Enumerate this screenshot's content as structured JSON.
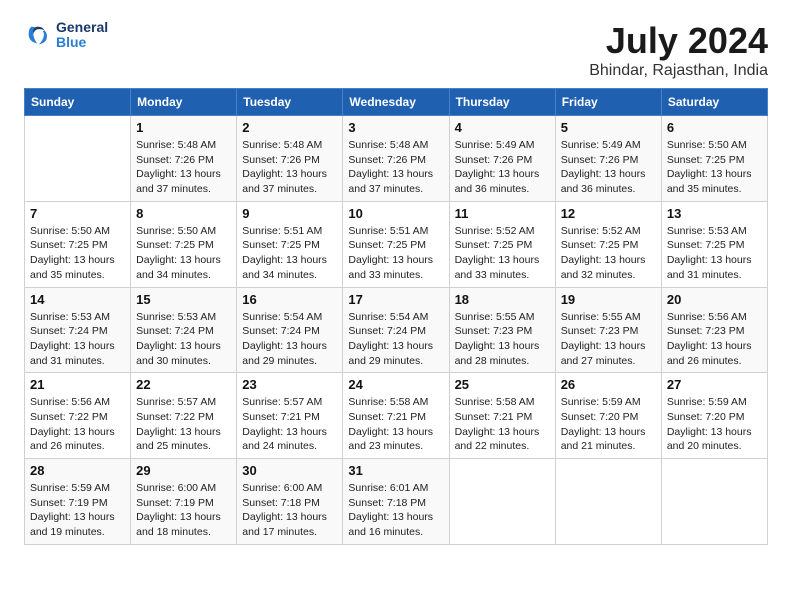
{
  "header": {
    "logo_general": "General",
    "logo_blue": "Blue",
    "month_title": "July 2024",
    "location": "Bhindar, Rajasthan, India"
  },
  "calendar": {
    "weekdays": [
      "Sunday",
      "Monday",
      "Tuesday",
      "Wednesday",
      "Thursday",
      "Friday",
      "Saturday"
    ],
    "weeks": [
      [
        {
          "day": "",
          "info": ""
        },
        {
          "day": "1",
          "info": "Sunrise: 5:48 AM\nSunset: 7:26 PM\nDaylight: 13 hours\nand 37 minutes."
        },
        {
          "day": "2",
          "info": "Sunrise: 5:48 AM\nSunset: 7:26 PM\nDaylight: 13 hours\nand 37 minutes."
        },
        {
          "day": "3",
          "info": "Sunrise: 5:48 AM\nSunset: 7:26 PM\nDaylight: 13 hours\nand 37 minutes."
        },
        {
          "day": "4",
          "info": "Sunrise: 5:49 AM\nSunset: 7:26 PM\nDaylight: 13 hours\nand 36 minutes."
        },
        {
          "day": "5",
          "info": "Sunrise: 5:49 AM\nSunset: 7:26 PM\nDaylight: 13 hours\nand 36 minutes."
        },
        {
          "day": "6",
          "info": "Sunrise: 5:50 AM\nSunset: 7:25 PM\nDaylight: 13 hours\nand 35 minutes."
        }
      ],
      [
        {
          "day": "7",
          "info": "Sunrise: 5:50 AM\nSunset: 7:25 PM\nDaylight: 13 hours\nand 35 minutes."
        },
        {
          "day": "8",
          "info": "Sunrise: 5:50 AM\nSunset: 7:25 PM\nDaylight: 13 hours\nand 34 minutes."
        },
        {
          "day": "9",
          "info": "Sunrise: 5:51 AM\nSunset: 7:25 PM\nDaylight: 13 hours\nand 34 minutes."
        },
        {
          "day": "10",
          "info": "Sunrise: 5:51 AM\nSunset: 7:25 PM\nDaylight: 13 hours\nand 33 minutes."
        },
        {
          "day": "11",
          "info": "Sunrise: 5:52 AM\nSunset: 7:25 PM\nDaylight: 13 hours\nand 33 minutes."
        },
        {
          "day": "12",
          "info": "Sunrise: 5:52 AM\nSunset: 7:25 PM\nDaylight: 13 hours\nand 32 minutes."
        },
        {
          "day": "13",
          "info": "Sunrise: 5:53 AM\nSunset: 7:25 PM\nDaylight: 13 hours\nand 31 minutes."
        }
      ],
      [
        {
          "day": "14",
          "info": "Sunrise: 5:53 AM\nSunset: 7:24 PM\nDaylight: 13 hours\nand 31 minutes."
        },
        {
          "day": "15",
          "info": "Sunrise: 5:53 AM\nSunset: 7:24 PM\nDaylight: 13 hours\nand 30 minutes."
        },
        {
          "day": "16",
          "info": "Sunrise: 5:54 AM\nSunset: 7:24 PM\nDaylight: 13 hours\nand 29 minutes."
        },
        {
          "day": "17",
          "info": "Sunrise: 5:54 AM\nSunset: 7:24 PM\nDaylight: 13 hours\nand 29 minutes."
        },
        {
          "day": "18",
          "info": "Sunrise: 5:55 AM\nSunset: 7:23 PM\nDaylight: 13 hours\nand 28 minutes."
        },
        {
          "day": "19",
          "info": "Sunrise: 5:55 AM\nSunset: 7:23 PM\nDaylight: 13 hours\nand 27 minutes."
        },
        {
          "day": "20",
          "info": "Sunrise: 5:56 AM\nSunset: 7:23 PM\nDaylight: 13 hours\nand 26 minutes."
        }
      ],
      [
        {
          "day": "21",
          "info": "Sunrise: 5:56 AM\nSunset: 7:22 PM\nDaylight: 13 hours\nand 26 minutes."
        },
        {
          "day": "22",
          "info": "Sunrise: 5:57 AM\nSunset: 7:22 PM\nDaylight: 13 hours\nand 25 minutes."
        },
        {
          "day": "23",
          "info": "Sunrise: 5:57 AM\nSunset: 7:21 PM\nDaylight: 13 hours\nand 24 minutes."
        },
        {
          "day": "24",
          "info": "Sunrise: 5:58 AM\nSunset: 7:21 PM\nDaylight: 13 hours\nand 23 minutes."
        },
        {
          "day": "25",
          "info": "Sunrise: 5:58 AM\nSunset: 7:21 PM\nDaylight: 13 hours\nand 22 minutes."
        },
        {
          "day": "26",
          "info": "Sunrise: 5:59 AM\nSunset: 7:20 PM\nDaylight: 13 hours\nand 21 minutes."
        },
        {
          "day": "27",
          "info": "Sunrise: 5:59 AM\nSunset: 7:20 PM\nDaylight: 13 hours\nand 20 minutes."
        }
      ],
      [
        {
          "day": "28",
          "info": "Sunrise: 5:59 AM\nSunset: 7:19 PM\nDaylight: 13 hours\nand 19 minutes."
        },
        {
          "day": "29",
          "info": "Sunrise: 6:00 AM\nSunset: 7:19 PM\nDaylight: 13 hours\nand 18 minutes."
        },
        {
          "day": "30",
          "info": "Sunrise: 6:00 AM\nSunset: 7:18 PM\nDaylight: 13 hours\nand 17 minutes."
        },
        {
          "day": "31",
          "info": "Sunrise: 6:01 AM\nSunset: 7:18 PM\nDaylight: 13 hours\nand 16 minutes."
        },
        {
          "day": "",
          "info": ""
        },
        {
          "day": "",
          "info": ""
        },
        {
          "day": "",
          "info": ""
        }
      ]
    ]
  }
}
